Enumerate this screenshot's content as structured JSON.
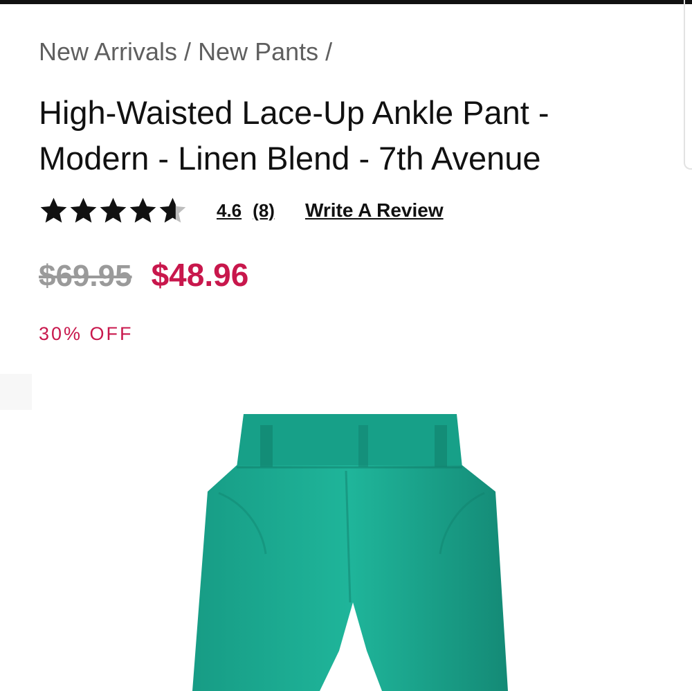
{
  "breadcrumb": [
    {
      "label": "New Arrivals"
    },
    {
      "label": "New Pants"
    }
  ],
  "breadcrumb_separator": "/",
  "product": {
    "title": "High-Waisted Lace-Up Ankle Pant - Modern - Linen Blend - 7th Avenue",
    "rating": {
      "stars_value": 4.6,
      "stars_max": 5,
      "value_label": "4.6",
      "count_label": "(8)",
      "write_review_label": "Write A Review",
      "star_icon": "star-icon"
    },
    "price": {
      "original": "$69.95",
      "sale": "$48.96"
    },
    "discount_label": "30% OFF",
    "image": {
      "depicts": "teal-pants",
      "color": "#1aa78e"
    }
  },
  "colors": {
    "accent_sale": "#c8174c",
    "text_muted": "#5f5f5f",
    "star_fill": "#111111",
    "star_empty": "#bdbdbd"
  }
}
